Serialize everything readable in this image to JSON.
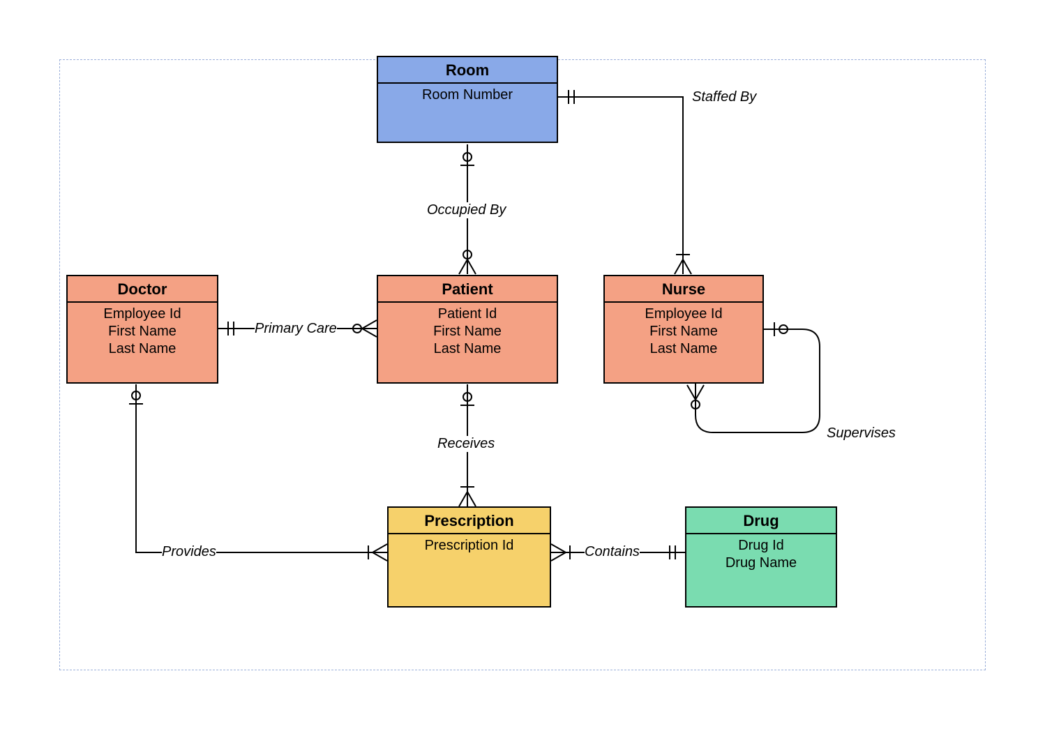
{
  "entities": {
    "room": {
      "title": "Room",
      "attrs": [
        "Room Number"
      ]
    },
    "doctor": {
      "title": "Doctor",
      "attrs": [
        "Employee Id",
        "First Name",
        "Last Name"
      ]
    },
    "patient": {
      "title": "Patient",
      "attrs": [
        "Patient Id",
        "First Name",
        "Last Name"
      ]
    },
    "nurse": {
      "title": "Nurse",
      "attrs": [
        "Employee Id",
        "First Name",
        "Last Name"
      ]
    },
    "prescription": {
      "title": "Prescription",
      "attrs": [
        "Prescription Id"
      ]
    },
    "drug": {
      "title": "Drug",
      "attrs": [
        "Drug Id",
        "Drug Name"
      ]
    }
  },
  "relationships": {
    "staffed_by": "Staffed By",
    "occupied_by": "Occupied By",
    "primary_care": "Primary Care",
    "receives": "Receives",
    "provides": "Provides",
    "contains": "Contains",
    "supervises": "Supervises"
  }
}
